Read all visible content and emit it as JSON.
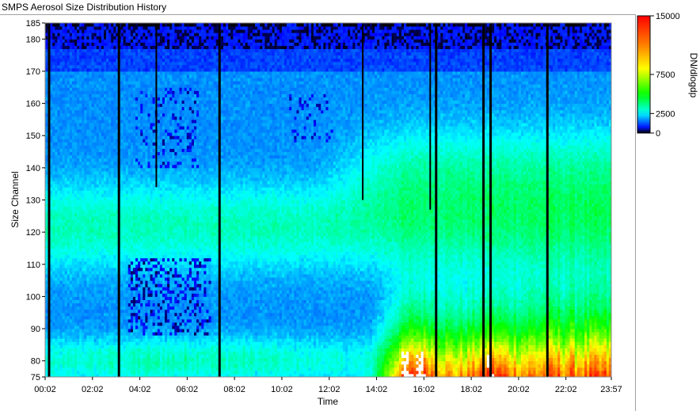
{
  "window": {
    "title": "SMPS Aerosol Size Distribution History"
  },
  "chart_data": {
    "type": "heatmap",
    "title": "",
    "xlabel": "Time",
    "ylabel": "Size Channel",
    "x_ticks": [
      "00:02",
      "02:02",
      "04:02",
      "06:02",
      "08:02",
      "10:02",
      "12:02",
      "14:02",
      "16:02",
      "18:02",
      "20:02",
      "22:02",
      "23:57"
    ],
    "x_tick_hours": [
      0.033,
      2.033,
      4.033,
      6.033,
      8.033,
      10.033,
      12.033,
      14.033,
      16.033,
      18.033,
      20.033,
      22.033,
      23.95
    ],
    "xlim_hours": [
      0.033,
      23.95
    ],
    "y_ticks": [
      75,
      80,
      90,
      100,
      110,
      120,
      130,
      140,
      150,
      160,
      170,
      180,
      185
    ],
    "ylim": [
      75,
      185
    ],
    "colorbar": {
      "label": "DN/dlogdp",
      "ticks": [
        {
          "label": "15000",
          "value": 15000
        },
        {
          "label": "7500",
          "value": 7500
        },
        {
          "label": "2500",
          "value": 2500
        },
        {
          "label": "0",
          "value": 0
        }
      ],
      "min": 0,
      "max": 15000,
      "colors": [
        "#000000",
        "#0000ff",
        "#00ffff",
        "#00ff00",
        "#ffff00",
        "#ff8000",
        "#ff0000"
      ]
    },
    "gap_lines": [
      {
        "time_hour": 0.2,
        "top_channel": 185,
        "bottom_channel": 75
      },
      {
        "time_hour": 3.15,
        "top_channel": 185,
        "bottom_channel": 75
      },
      {
        "time_hour": 4.73,
        "top_channel": 185,
        "bottom_channel": 134
      },
      {
        "time_hour": 7.4,
        "top_channel": 185,
        "bottom_channel": 75
      },
      {
        "time_hour": 13.45,
        "top_channel": 185,
        "bottom_channel": 130
      },
      {
        "time_hour": 16.3,
        "top_channel": 185,
        "bottom_channel": 127
      },
      {
        "time_hour": 16.55,
        "top_channel": 185,
        "bottom_channel": 75
      },
      {
        "time_hour": 18.55,
        "top_channel": 185,
        "bottom_channel": 75
      },
      {
        "time_hour": 18.85,
        "top_channel": 185,
        "bottom_channel": 75
      },
      {
        "time_hour": 21.25,
        "top_channel": 185,
        "bottom_channel": 75
      }
    ],
    "features": [
      {
        "region": "channels 177-185, all day",
        "level": "saturated high-channel band (purple/black)"
      },
      {
        "region": "channels 75-170, 00:00-12:00",
        "level": "≈1500-2500 (cyan), green patches at low channels"
      },
      {
        "region": "channels 90-165, 03:30-07:00",
        "level": "sparse low-count pixels (blue/purple)"
      },
      {
        "region": "channels 130-145, 12:00-24:00",
        "level": "≈3500-5000 (green)"
      },
      {
        "region": "channels 75-100, 14:00-24:00",
        "level": "≈7500-15000 (yellow to red), saturated white near 15:00-16:30 and 18:30-19:00"
      }
    ]
  }
}
